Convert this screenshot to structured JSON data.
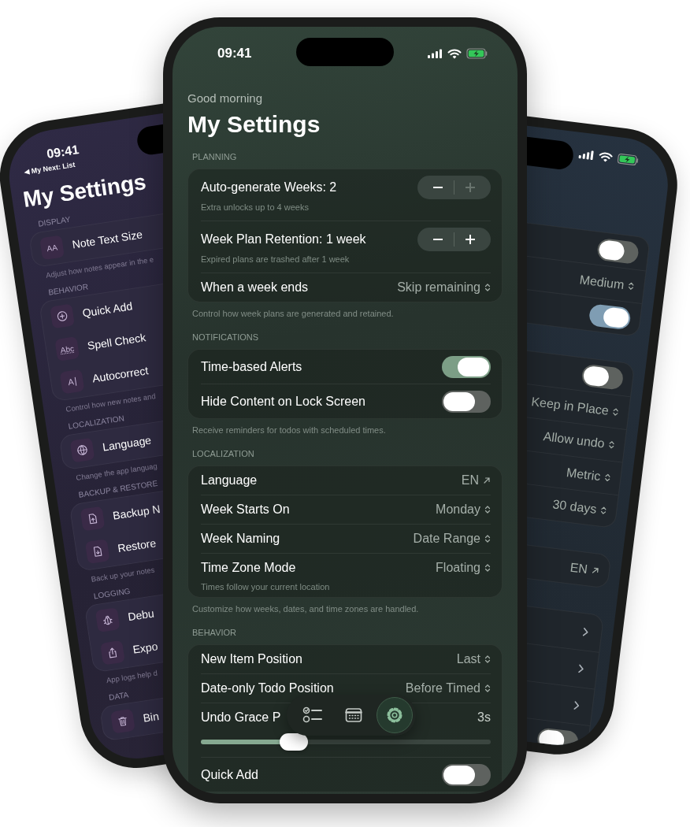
{
  "left_phone": {
    "status_bar": {
      "time": "09:41",
      "back_link": "◀ My Next: List"
    },
    "title": "My Settings",
    "sections": [
      {
        "header": "DISPLAY",
        "rows": [
          {
            "icon_text": "AA",
            "label": "Note Text Size"
          }
        ],
        "footer": "Adjust how notes appear in the e"
      },
      {
        "header": "BEHAVIOR",
        "rows": [
          {
            "label": "Quick Add"
          },
          {
            "icon_text": "Abc",
            "label": "Spell Check"
          },
          {
            "icon_text": "A",
            "label": "Autocorrect"
          }
        ],
        "footer": "Control how new notes and"
      },
      {
        "header": "LOCALIZATION",
        "rows": [
          {
            "label": "Language"
          }
        ],
        "footer": "Change the app languag"
      },
      {
        "header": "BACKUP & RESTORE",
        "rows": [
          {
            "label": "Backup N"
          },
          {
            "label": "Restore"
          }
        ],
        "footer": "Back up your notes"
      },
      {
        "header": "LOGGING",
        "rows": [
          {
            "label": "Debu"
          },
          {
            "label": "Expo"
          }
        ],
        "footer": "App logs help d"
      },
      {
        "header": "DATA",
        "rows": [
          {
            "label": "Bin"
          }
        ]
      }
    ]
  },
  "center_phone": {
    "status_bar": {
      "time": "09:41"
    },
    "greeting": "Good morning",
    "title": "My Settings",
    "sections": [
      {
        "header": "PLANNING",
        "rows": [
          {
            "kind": "stepper",
            "label": "Auto-generate Weeks: 2",
            "detail": "Extra unlocks up to 4 weeks",
            "minus_disabled": false,
            "plus_disabled": true
          },
          {
            "kind": "stepper",
            "label": "Week Plan Retention: 1 week",
            "detail": "Expired plans are trashed after 1 week",
            "minus_disabled": false,
            "plus_disabled": false
          },
          {
            "kind": "picker",
            "label": "When a week ends",
            "value": "Skip remaining"
          }
        ],
        "footer": "Control how week plans are generated and retained."
      },
      {
        "header": "NOTIFICATIONS",
        "rows": [
          {
            "kind": "toggle",
            "label": "Time-based Alerts",
            "on": true
          },
          {
            "kind": "toggle",
            "label": "Hide Content on Lock Screen",
            "on": false
          }
        ],
        "footer": "Receive reminders for todos with scheduled times."
      },
      {
        "header": "LOCALIZATION",
        "rows": [
          {
            "kind": "link",
            "label": "Language",
            "value": "EN"
          },
          {
            "kind": "picker",
            "label": "Week Starts On",
            "value": "Monday"
          },
          {
            "kind": "picker",
            "label": "Week Naming",
            "value": "Date Range"
          },
          {
            "kind": "picker",
            "label": "Time Zone Mode",
            "value": "Floating",
            "detail": "Times follow your current location"
          }
        ],
        "footer": "Customize how weeks, dates, and time zones are handled."
      },
      {
        "header": "BEHAVIOR",
        "rows": [
          {
            "kind": "picker",
            "label": "New Item Position",
            "value": "Last"
          },
          {
            "kind": "picker",
            "label": "Date-only Todo Position",
            "value": "Before Timed"
          },
          {
            "kind": "slider",
            "label": "Undo Grace P",
            "value": "3s",
            "level": 0.32
          },
          {
            "kind": "toggle",
            "label": "Quick Add",
            "on": false
          }
        ]
      }
    ],
    "tab_bar": [
      {
        "selected": false
      },
      {
        "selected": false
      },
      {
        "selected": true
      }
    ]
  },
  "right_phone": {
    "groups": [
      {
        "rows": [
          {
            "kind": "toggle",
            "on": false
          },
          {
            "kind": "picker",
            "value": "Medium"
          },
          {
            "kind": "toggle",
            "on": true
          }
        ]
      },
      {
        "rows": [
          {
            "kind": "toggle",
            "on": false
          },
          {
            "kind": "picker",
            "value": "Keep in Place"
          },
          {
            "kind": "picker",
            "value": "Allow undo"
          },
          {
            "kind": "picker",
            "value": "Metric"
          },
          {
            "kind": "picker",
            "value": "30 days"
          }
        ]
      },
      {
        "rows": [
          {
            "kind": "link",
            "value": "EN"
          }
        ]
      },
      {
        "rows": [
          {
            "kind": "chevron"
          },
          {
            "kind": "chevron"
          },
          {
            "kind": "chevron"
          },
          {
            "kind": "toggle",
            "on": false
          }
        ]
      }
    ]
  }
}
